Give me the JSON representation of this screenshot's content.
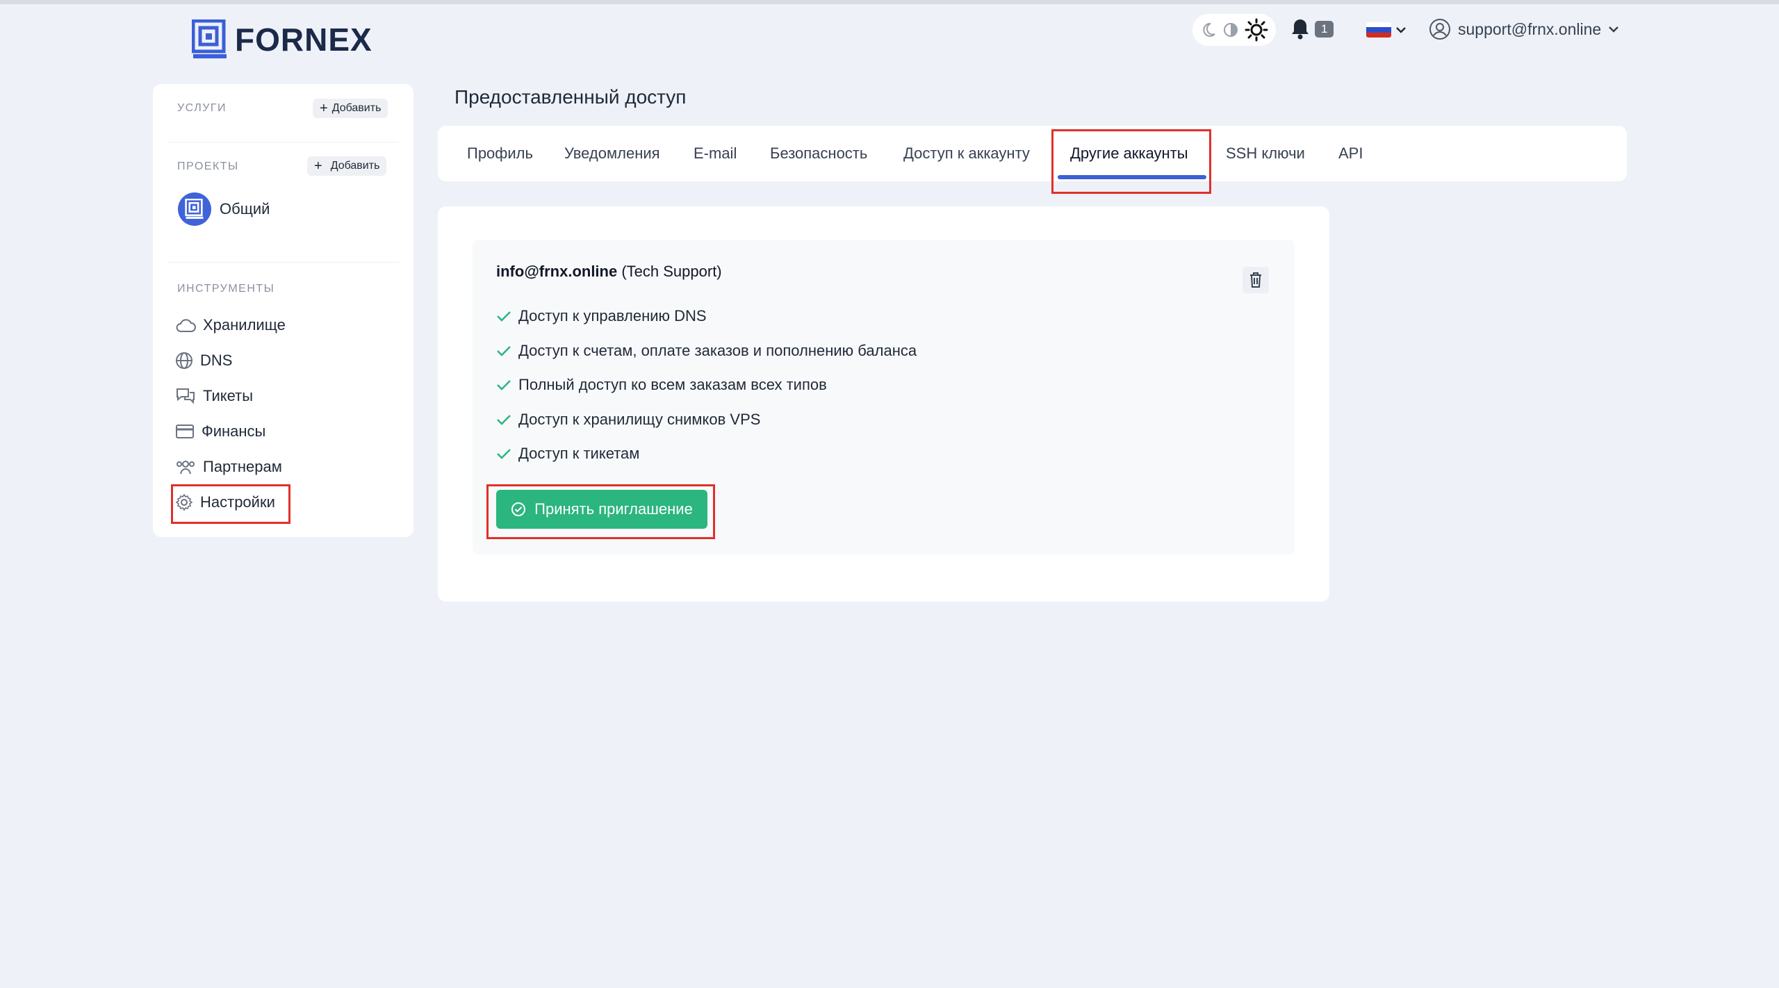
{
  "header": {
    "logo_text": "FORNEX",
    "notifications_count": "1",
    "user_email": "support@frnx.online"
  },
  "sidebar": {
    "services_label": "УСЛУГИ",
    "services_add": "Добавить",
    "projects_label": "ПРОЕКТЫ",
    "projects_add": "Добавить",
    "project_name": "Общий",
    "tools_label": "ИНСТРУМЕНТЫ",
    "items": [
      {
        "label": "Хранилище",
        "icon": "cloud-icon"
      },
      {
        "label": "DNS",
        "icon": "globe-icon"
      },
      {
        "label": "Тикеты",
        "icon": "chat-icon"
      },
      {
        "label": "Финансы",
        "icon": "card-icon"
      },
      {
        "label": "Партнерам",
        "icon": "users-icon"
      },
      {
        "label": "Настройки",
        "icon": "gear-icon"
      }
    ]
  },
  "main": {
    "page_title": "Предоставленный доступ",
    "tabs": [
      {
        "label": "Профиль"
      },
      {
        "label": "Уведомления"
      },
      {
        "label": "E-mail"
      },
      {
        "label": "Безопасность"
      },
      {
        "label": "Доступ к аккаунту"
      },
      {
        "label": "Другие аккаунты"
      },
      {
        "label": "SSH ключи"
      },
      {
        "label": "API"
      }
    ],
    "active_tab": "Другие аккаунты",
    "account": {
      "email": "info@frnx.online",
      "name": "(Tech Support)",
      "permissions": [
        "Доступ к управлению DNS",
        "Доступ к счетам, оплате заказов и пополнению баланса",
        "Полный доступ ко всем заказам всех типов",
        "Доступ к хранилищу снимков VPS",
        "Доступ к тикетам"
      ],
      "accept_label": "Принять приглашение"
    }
  },
  "colors": {
    "accent": "#3b5fd9",
    "success": "#2bb57f",
    "highlight": "#e0302a",
    "background": "#eef1f7"
  }
}
